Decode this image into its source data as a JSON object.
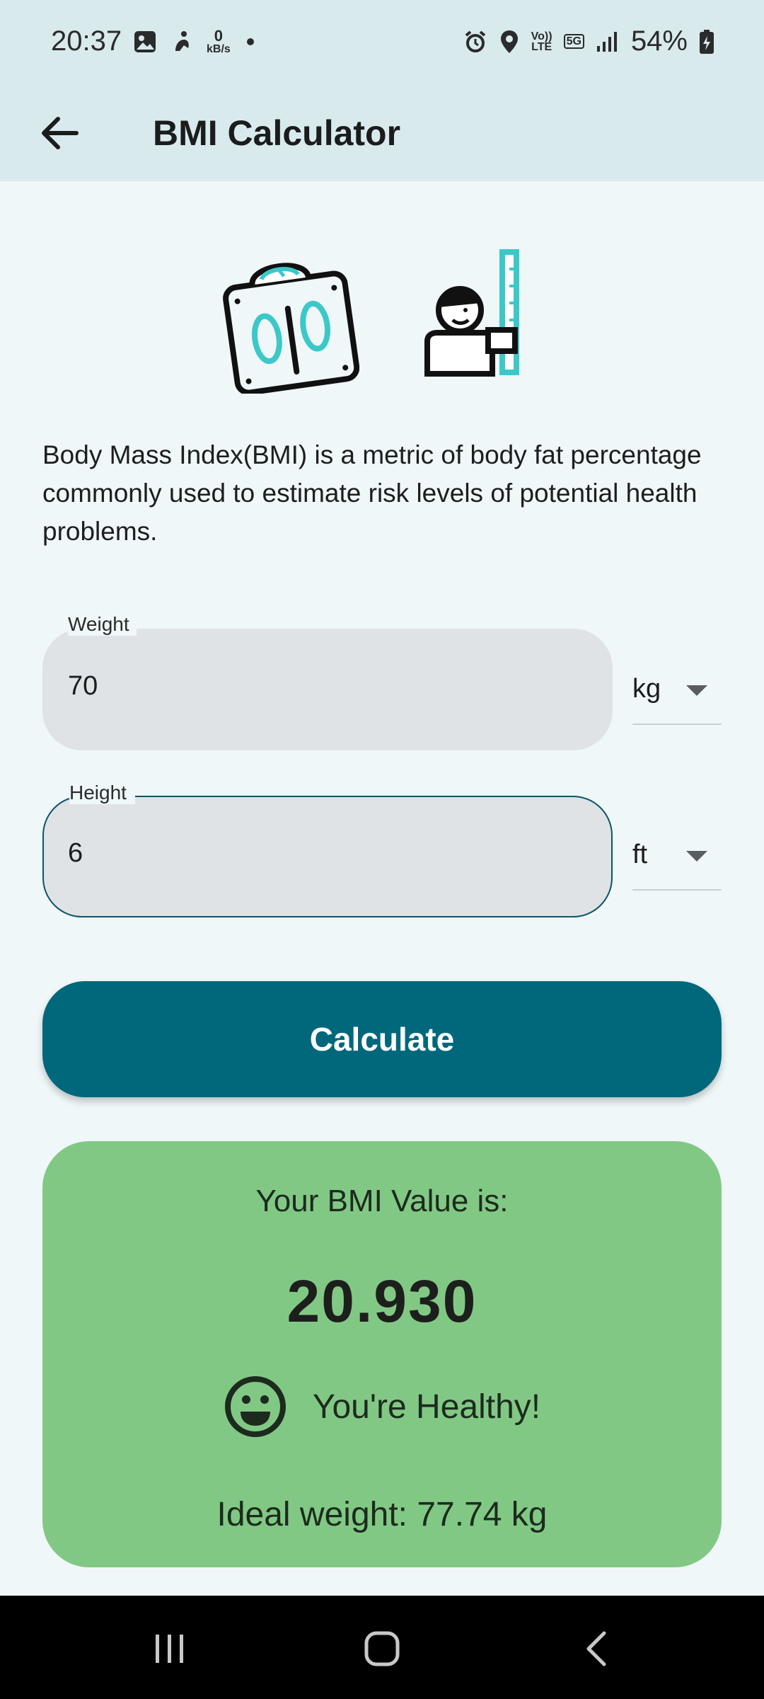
{
  "status_bar": {
    "time": "20:37",
    "net_speed_value": "0",
    "net_speed_unit": "kB/s",
    "volte_top": "Vo))",
    "volte_bottom": "LTE",
    "network": "5G",
    "battery": "54%"
  },
  "app_bar": {
    "title": "BMI Calculator"
  },
  "intro": {
    "description": "Body Mass Index(BMI) is a metric of body fat percentage commonly used to estimate risk levels of potential health problems."
  },
  "form": {
    "weight": {
      "label": "Weight",
      "value": "70",
      "unit": "kg"
    },
    "height": {
      "label": "Height",
      "value": "6",
      "unit": "ft"
    },
    "calculate_label": "Calculate"
  },
  "result": {
    "heading": "Your BMI Value is:",
    "value": "20.930",
    "status": "You're Healthy!",
    "ideal_weight": "Ideal weight: 77.74 kg",
    "card_color": "#82c885"
  },
  "colors": {
    "primary": "#01687c",
    "accent_teal": "#3cc8c8",
    "app_bar_bg": "#d9eaed",
    "page_bg": "#eff7f8"
  }
}
